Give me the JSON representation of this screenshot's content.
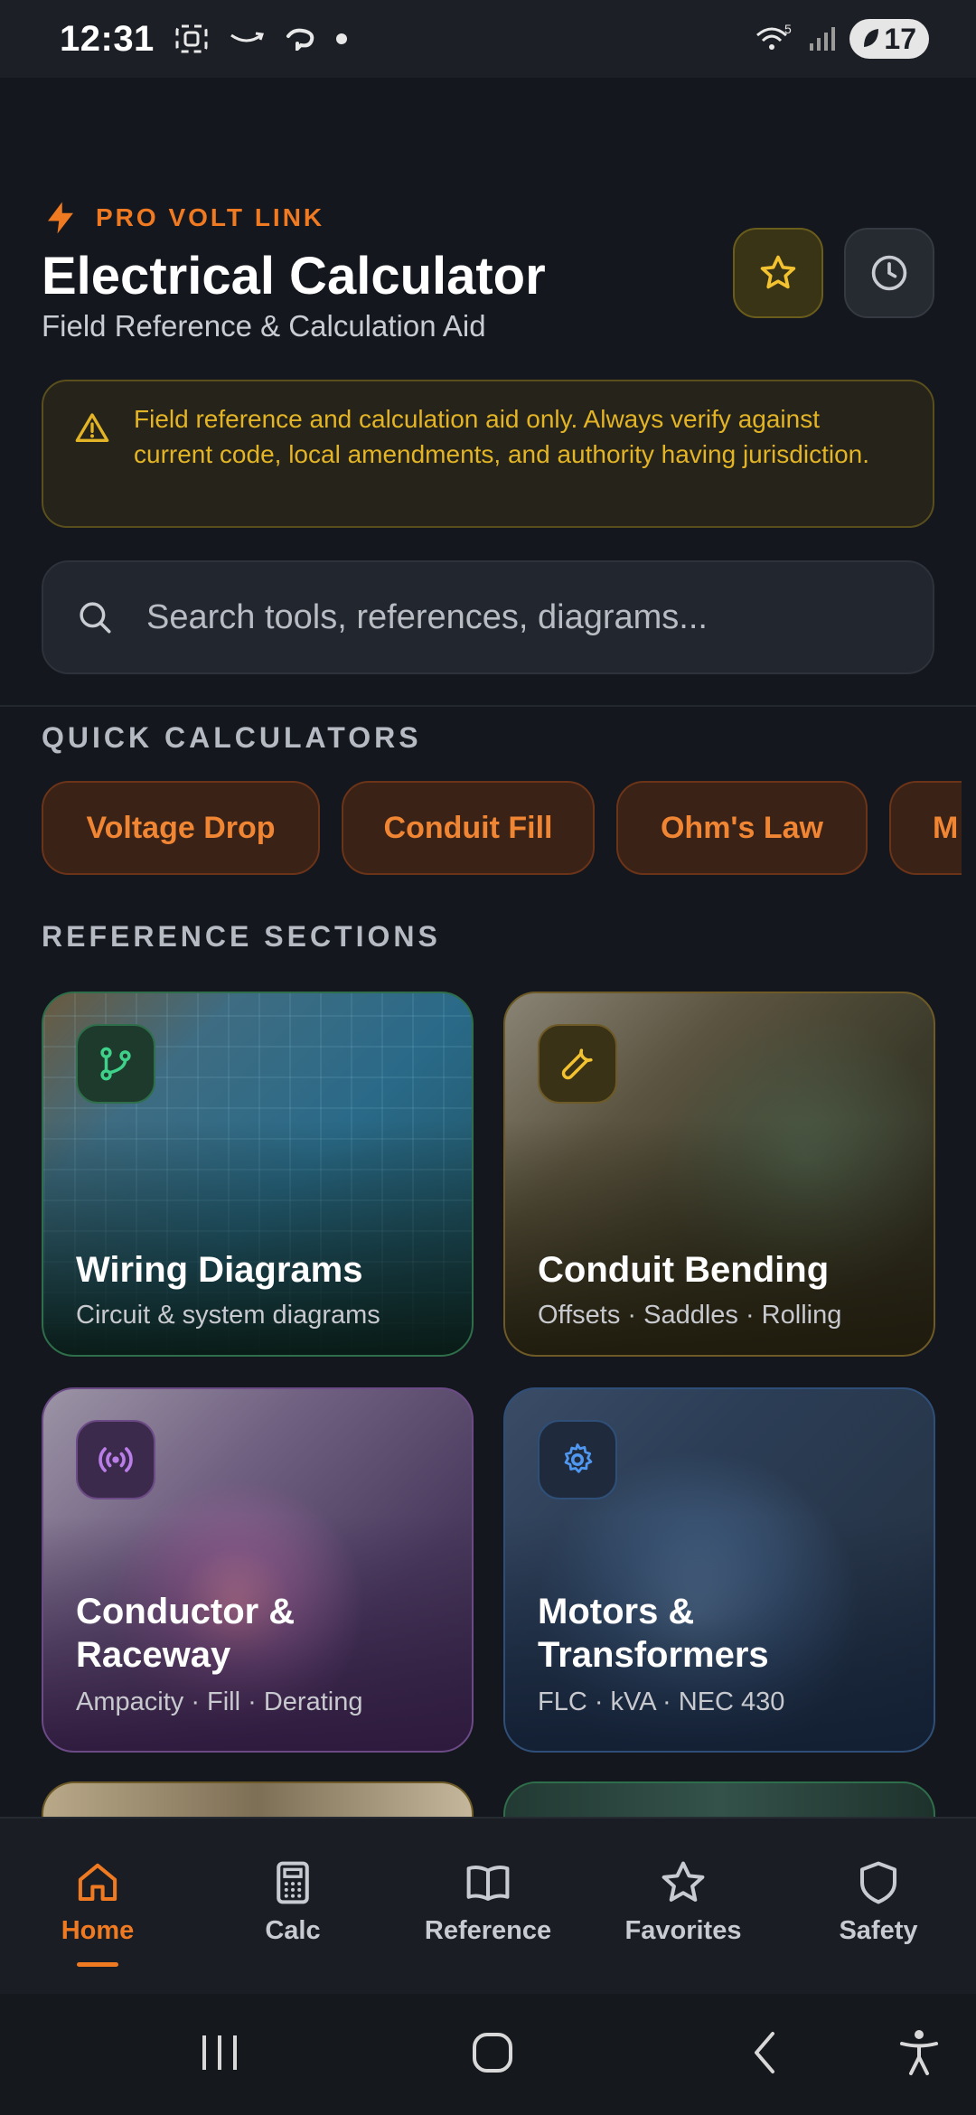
{
  "status_bar": {
    "time": "12:31",
    "icons_left": [
      "screen-record-icon",
      "amazon-icon",
      "cloud-icon",
      "dot-icon"
    ],
    "wifi_badge": "5",
    "battery": "17"
  },
  "header": {
    "brand": "PRO VOLT LINK",
    "title": "Electrical Calculator",
    "subtitle": "Field Reference & Calculation Aid",
    "favorite_icon": "star-icon",
    "history_icon": "clock-icon"
  },
  "disclaimer": {
    "text": "Field reference and calculation aid only. Always verify against current code, local amendments, and authority having jurisdiction.",
    "icon": "warning-icon",
    "color": "#e3b425"
  },
  "search": {
    "placeholder": "Search tools, references, diagrams..."
  },
  "quick_calculators": {
    "label": "QUICK CALCULATORS",
    "items": [
      "Voltage Drop",
      "Conduit Fill",
      "Ohm's Law",
      "M"
    ]
  },
  "reference_sections": {
    "label": "REFERENCE SECTIONS",
    "cards": [
      {
        "title": "Wiring Diagrams",
        "subtitle": "Circuit & system diagrams",
        "icon": "branch-icon",
        "accent": "#3fd18a"
      },
      {
        "title": "Conduit Bending",
        "subtitle": "Offsets · Saddles · Rolling",
        "icon": "wrench-icon",
        "accent": "#f2c230"
      },
      {
        "title": "Conductor &",
        "title2": "Raceway",
        "subtitle": "Ampacity · Fill · Derating",
        "icon": "signal-icon",
        "accent": "#b97ee8"
      },
      {
        "title": "Motors &",
        "title2": "Transformers",
        "subtitle": "FLC · kVA · NEC 430",
        "icon": "gear-icon",
        "accent": "#4f97f0"
      }
    ]
  },
  "bottom_nav": {
    "items": [
      {
        "label": "Home",
        "icon": "home-icon",
        "active": true
      },
      {
        "label": "Calc",
        "icon": "calculator-icon",
        "active": false
      },
      {
        "label": "Reference",
        "icon": "book-icon",
        "active": false
      },
      {
        "label": "Favorites",
        "icon": "star-icon",
        "active": false
      },
      {
        "label": "Safety",
        "icon": "shield-icon",
        "active": false
      }
    ],
    "accent": "#f07a22"
  }
}
